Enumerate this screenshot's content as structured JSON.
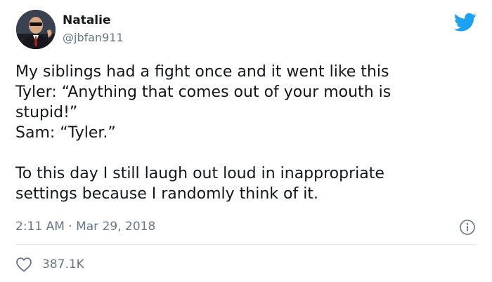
{
  "author": {
    "name": "Natalie",
    "handle": "@jbfan911",
    "avatar_icon": "profile-photo"
  },
  "tweet": {
    "lines": [
      "My siblings had a fight once and it went like this",
      "Tyler: “Anything that comes out of your mouth is",
      "stupid!”",
      "Sam: “Tyler.”",
      "",
      "To this day I still laugh out loud in inappropriate",
      "settings because I randomly think of it."
    ],
    "timestamp": "2:11 AM · Mar 29, 2018"
  },
  "actions": {
    "like_count": "387.1K"
  },
  "icons": {
    "brand": "twitter-bird-icon",
    "info": "info-icon",
    "like": "heart-icon"
  },
  "colors": {
    "brand_blue": "#1da1f2",
    "text_primary": "#14171a",
    "text_secondary": "#657786",
    "divider": "#e1e8ed"
  }
}
